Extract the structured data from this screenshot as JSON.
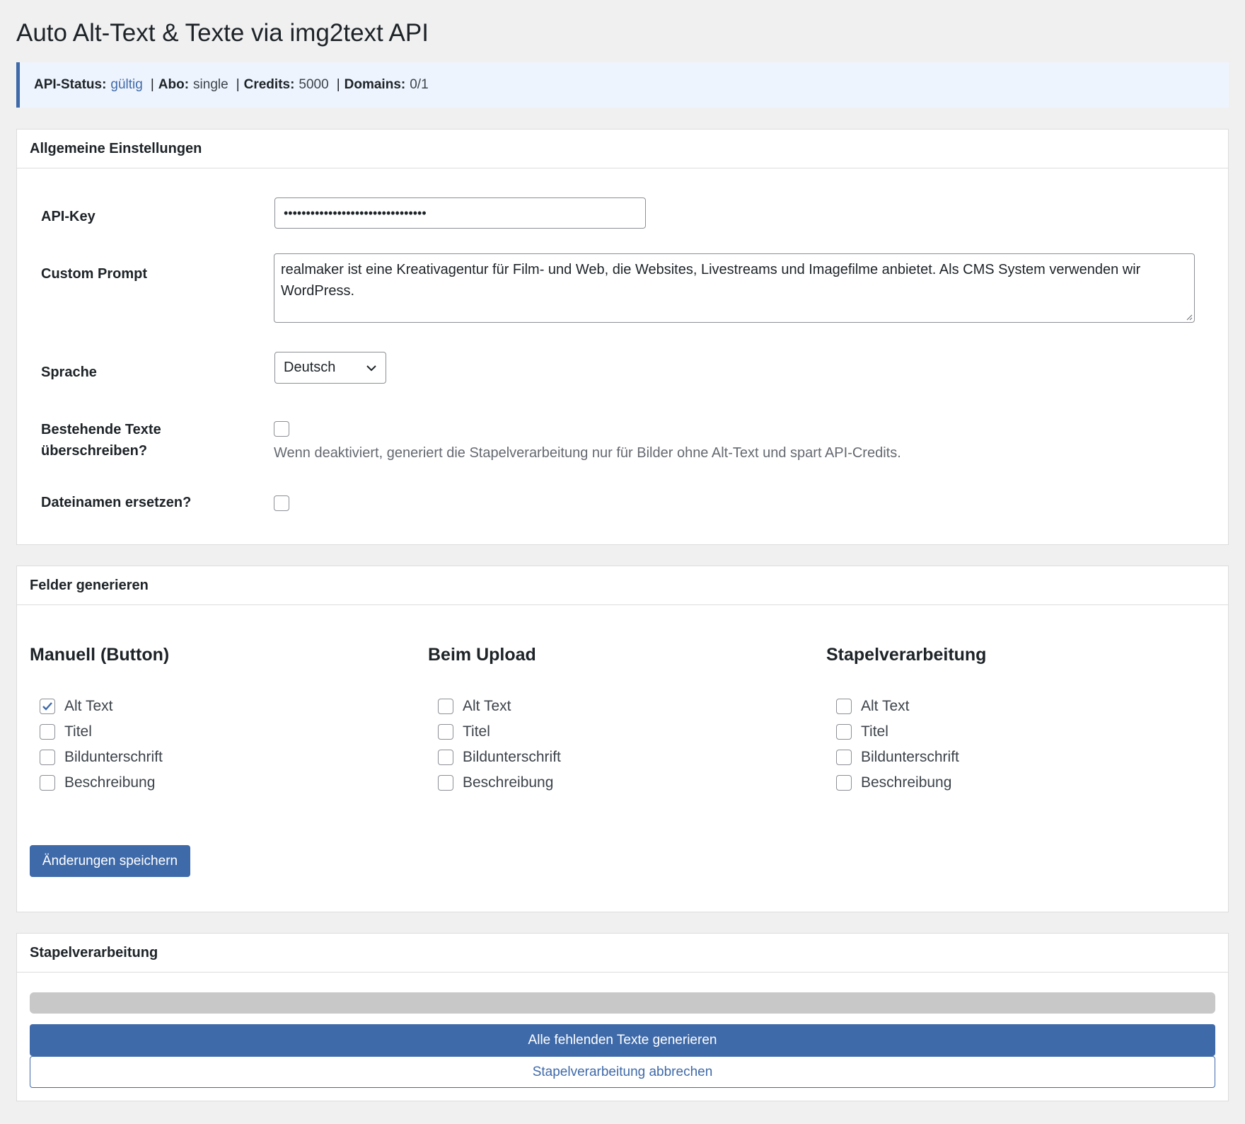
{
  "page": {
    "title": "Auto Alt-Text & Texte via img2text API"
  },
  "status": {
    "api_label": "API-Status:",
    "api_value": "gültig",
    "sep1": "|",
    "abo_label": "Abo:",
    "abo_value": "single",
    "sep2": "|",
    "credits_label": "Credits:",
    "credits_value": "5000",
    "sep3": "|",
    "domains_label": "Domains:",
    "domains_value": "0/1"
  },
  "general": {
    "heading": "Allgemeine Einstellungen",
    "api_key_label": "API-Key",
    "api_key_value": "••••••••••••••••••••••••••••••••",
    "prompt_label": "Custom Prompt",
    "prompt_value": "realmaker ist eine Kreativagentur für Film- und Web, die Websites, Livestreams und Imagefilme anbietet. Als CMS System verwenden wir WordPress.",
    "language_label": "Sprache",
    "language_value": "Deutsch",
    "overwrite_label_line1": "Bestehende Texte",
    "overwrite_label_line2": "überschreiben?",
    "overwrite_checked": false,
    "overwrite_desc": "Wenn deaktiviert, generiert die Stapelverarbeitung nur für Bilder ohne Alt-Text und spart API-Credits.",
    "rename_label": "Dateinamen ersetzen?",
    "rename_checked": false
  },
  "fields": {
    "heading": "Felder generieren",
    "columns": [
      {
        "title": "Manuell (Button)",
        "options": [
          {
            "label": "Alt Text",
            "checked": true
          },
          {
            "label": "Titel",
            "checked": false
          },
          {
            "label": "Bildunterschrift",
            "checked": false
          },
          {
            "label": "Beschreibung",
            "checked": false
          }
        ]
      },
      {
        "title": "Beim Upload",
        "options": [
          {
            "label": "Alt Text",
            "checked": false
          },
          {
            "label": "Titel",
            "checked": false
          },
          {
            "label": "Bildunterschrift",
            "checked": false
          },
          {
            "label": "Beschreibung",
            "checked": false
          }
        ]
      },
      {
        "title": "Stapelverarbeitung",
        "options": [
          {
            "label": "Alt Text",
            "checked": false
          },
          {
            "label": "Titel",
            "checked": false
          },
          {
            "label": "Bildunterschrift",
            "checked": false
          },
          {
            "label": "Beschreibung",
            "checked": false
          }
        ]
      }
    ],
    "save_label": "Änderungen speichern"
  },
  "batch": {
    "heading": "Stapelverarbeitung",
    "progress": 0,
    "generate_label": "Alle fehlenden Texte generieren",
    "cancel_label": "Stapelverarbeitung abbrechen"
  },
  "colors": {
    "accent": "#3f6aa9",
    "background": "#f0f0f1",
    "notice": "#eef4fd"
  }
}
